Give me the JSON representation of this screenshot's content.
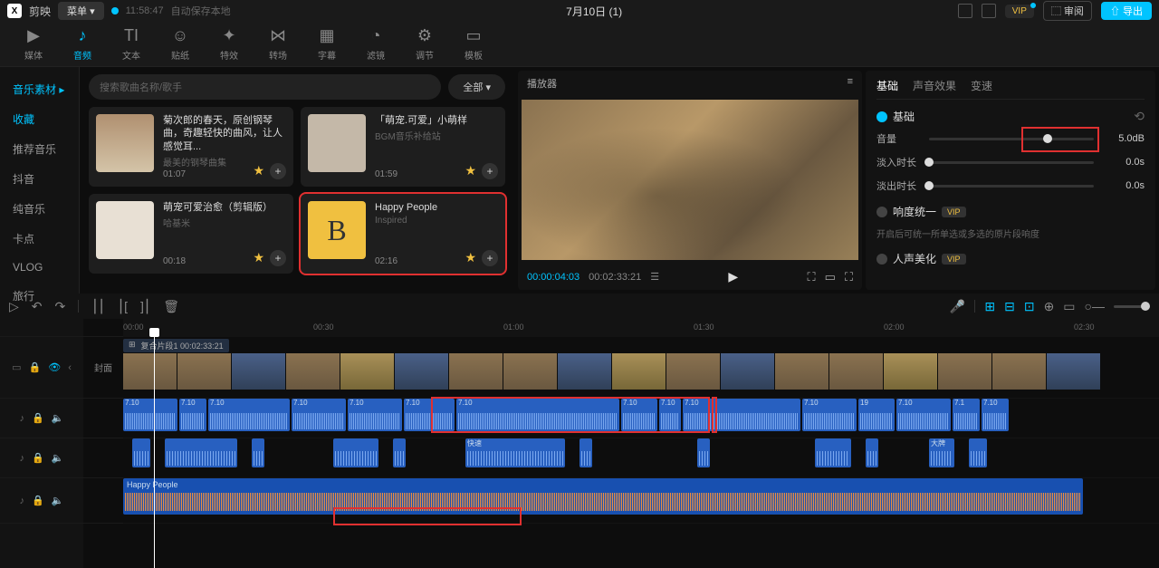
{
  "titlebar": {
    "logo": "X",
    "app_name": "剪映",
    "menu": "菜单 ▾",
    "time": "11:58:47",
    "autosave": "自动保存本地",
    "project": "7月10日 (1)",
    "vip": "VIP",
    "review": "⬚ 审阅",
    "export": "⇧ 导出"
  },
  "top_tabs": [
    {
      "icon": "▶",
      "label": "媒体"
    },
    {
      "icon": "♪",
      "label": "音频"
    },
    {
      "icon": "TI",
      "label": "文本"
    },
    {
      "icon": "☺",
      "label": "贴纸"
    },
    {
      "icon": "✦",
      "label": "特效"
    },
    {
      "icon": "⋈",
      "label": "转场"
    },
    {
      "icon": "▦",
      "label": "字幕"
    },
    {
      "icon": "◔",
      "label": "滤镜"
    },
    {
      "icon": "⚙",
      "label": "调节"
    },
    {
      "icon": "▭",
      "label": "模板"
    }
  ],
  "left_nav": {
    "header": "音乐素材",
    "items": [
      "收藏",
      "推荐音乐",
      "抖音",
      "纯音乐",
      "卡点",
      "VLOG",
      "旅行"
    ]
  },
  "search": {
    "placeholder": "搜索歌曲名称/歌手",
    "all": "全部 ▾"
  },
  "music_cards": [
    {
      "title": "菊次郎的春天，原创钢琴曲，奇趣轻快的曲风，让人感觉耳...",
      "subtitle": "最美的钢琴曲集",
      "duration": "01:07"
    },
    {
      "title": "「萌宠.可爱」小萌样",
      "subtitle": "BGM音乐补给站",
      "duration": "01:59"
    },
    {
      "title": "萌宠可爱治愈（剪辑版）",
      "subtitle": "哈基米",
      "duration": "00:18"
    },
    {
      "title": "Happy People",
      "subtitle": "Inspired",
      "duration": "02:16"
    }
  ],
  "player": {
    "title": "播放器",
    "time_current": "00:00:04:03",
    "time_total": "00:02:33:21"
  },
  "props": {
    "tabs": [
      "基础",
      "声音效果",
      "变速"
    ],
    "section_basic": "基础",
    "volume_label": "音量",
    "volume_value": "5.0dB",
    "fadein_label": "淡入时长",
    "fadein_value": "0.0s",
    "fadeout_label": "淡出时长",
    "fadeout_value": "0.0s",
    "loudness_label": "响度统一",
    "loudness_desc": "开启后可统一所单选或多选的原片段响度",
    "voice_label": "人声美化",
    "vip": "VIP"
  },
  "timeline": {
    "ruler": [
      "00:00",
      "00:30",
      "01:00",
      "01:30",
      "02:00",
      "02:30"
    ],
    "compound_label": "复合片段1  00:02:33:21",
    "cover": "封面",
    "audio_tag": "7.10",
    "fast_tag": "快速",
    "big_tag": "大牌",
    "music_track": "Happy People"
  }
}
